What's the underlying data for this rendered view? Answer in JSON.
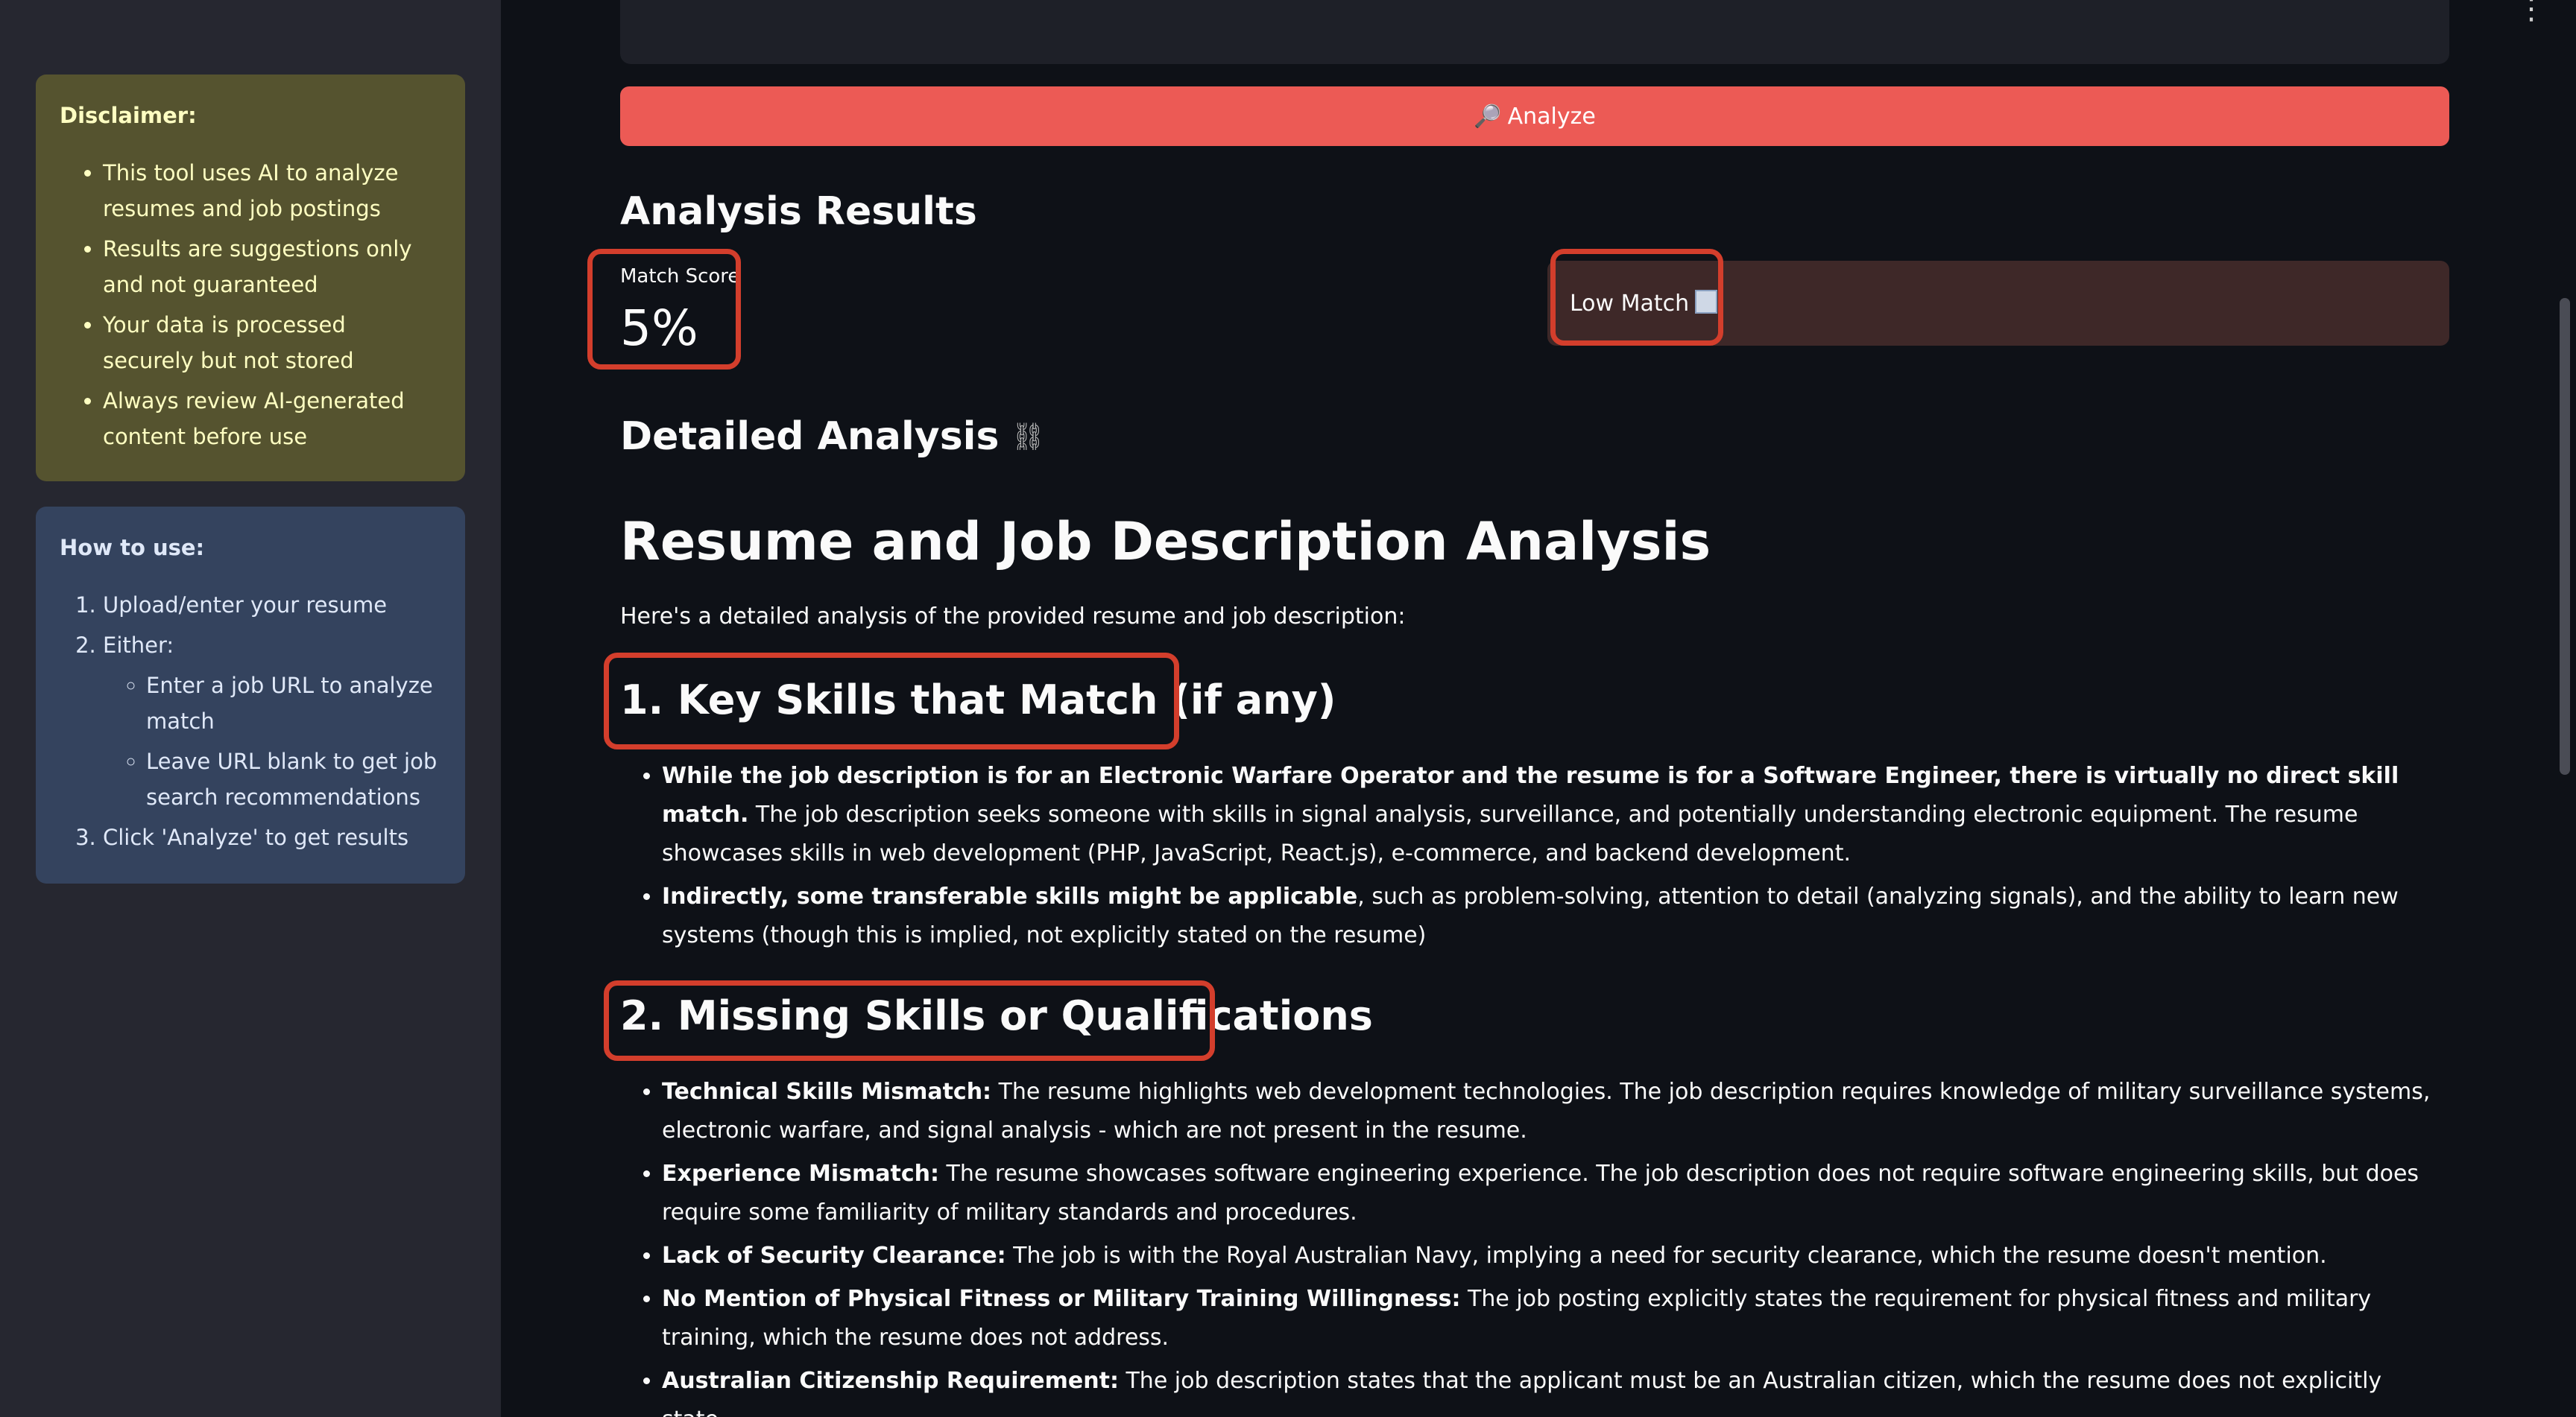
{
  "sidebar": {
    "disclaimer": {
      "title": "Disclaimer:",
      "items": [
        "This tool uses AI to analyze resumes and job postings",
        "Results are suggestions only and not guaranteed",
        "Your data is processed securely but not stored",
        "Always review AI-generated content before use"
      ]
    },
    "howto": {
      "title": "How to use:",
      "step1": "Upload/enter your resume",
      "step2": "Either:",
      "step2_sub": [
        "Enter a job URL to analyze match",
        "Leave URL blank to get job search recommendations"
      ],
      "step3": "Click 'Analyze' to get results"
    }
  },
  "main": {
    "analyze_icon": "🔎",
    "analyze_label": "Analyze",
    "results_heading": "Analysis Results",
    "match_score_label": "Match Score",
    "match_score_value": "5%",
    "match_status": "Low Match",
    "detailed_heading": "Detailed Analysis",
    "link_icon": "⛓",
    "report_title": "Resume and Job Description Analysis",
    "intro": "Here's a detailed analysis of the provided resume and job description:",
    "section1": {
      "heading": "1. Key Skills that Match (if any)",
      "items": [
        {
          "bold": "While the job description is for an Electronic Warfare Operator and the resume is for a Software Engineer, there is virtually no direct skill match.",
          "text": " The job description seeks someone with skills in signal analysis, surveillance, and potentially understanding electronic equipment. The resume showcases skills in web development (PHP, JavaScript, React.js), e-commerce, and backend development."
        },
        {
          "bold": "Indirectly, some transferable skills might be applicable",
          "text": ", such as problem-solving, attention to detail (analyzing signals), and the ability to learn new systems (though this is implied, not explicitly stated on the resume)"
        }
      ]
    },
    "section2": {
      "heading": "2. Missing Skills or Qualifications",
      "items": [
        {
          "bold": "Technical Skills Mismatch:",
          "text": " The resume highlights web development technologies. The job description requires knowledge of military surveillance systems, electronic warfare, and signal analysis - which are not present in the resume."
        },
        {
          "bold": "Experience Mismatch:",
          "text": " The resume showcases software engineering experience. The job description does not require software engineering skills, but does require some familiarity of military standards and procedures."
        },
        {
          "bold": "Lack of Security Clearance:",
          "text": " The job is with the Royal Australian Navy, implying a need for security clearance, which the resume doesn't mention."
        },
        {
          "bold": "No Mention of Physical Fitness or Military Training Willingness:",
          "text": " The job posting explicitly states the requirement for physical fitness and military training, which the resume does not address."
        },
        {
          "bold": "Australian Citizenship Requirement:",
          "text": " The job description states that the applicant must be an Australian citizen, which the resume does not explicitly state."
        }
      ]
    }
  }
}
